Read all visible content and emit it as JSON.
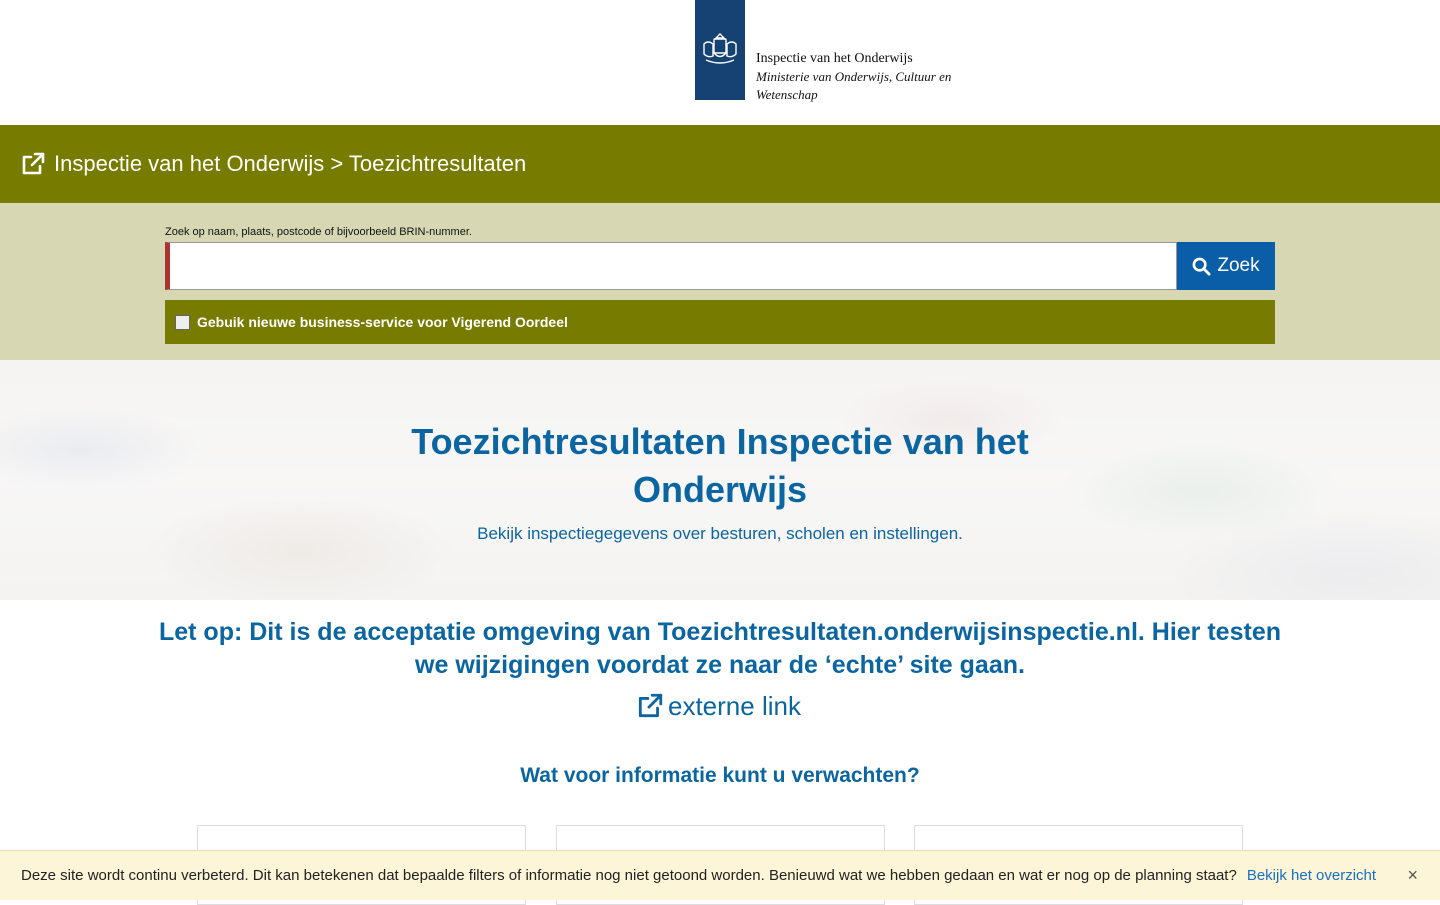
{
  "header": {
    "logo_line1": "Inspectie van het Onderwijs",
    "logo_line2": "Ministerie van Onderwijs, Cultuur en",
    "logo_line3": "Wetenschap"
  },
  "topbar": {
    "breadcrumb": "Inspectie van het Onderwijs > Toezichtresultaten",
    "color": "#777c00"
  },
  "search": {
    "label": "Zoek op naam, plaats, postcode of bijvoorbeeld BRIN-nummer.",
    "value": "",
    "button_label": "Zoek",
    "button_color": "#0a5ea8"
  },
  "option": {
    "checkbox_label": "Gebuik nieuwe business-service voor Vigerend Oordeel",
    "checked": false
  },
  "hero": {
    "title": "Toezichtresultaten Inspectie van het Onderwijs",
    "subtitle": "Bekijk inspectiegegevens over besturen, scholen en instellingen."
  },
  "notice": {
    "text": "Let op: Dit is de acceptatie omgeving van Toezichtresultaten.onderwijsinspectie.nl. Hier testen we wijzigingen voordat ze naar de ‘echte’ site gaan.",
    "link_label": "externe link"
  },
  "info": {
    "heading": "Wat voor informatie kunt u verwachten?"
  },
  "banner": {
    "message": "Deze site wordt continu verbeterd. Dit kan betekenen dat bepaalde filters of informatie nog niet getoond worden. Benieuwd wat we hebben gedaan en wat er nog op de planning staat?",
    "link_label": "Bekijk het overzicht",
    "close_symbol": "×"
  }
}
